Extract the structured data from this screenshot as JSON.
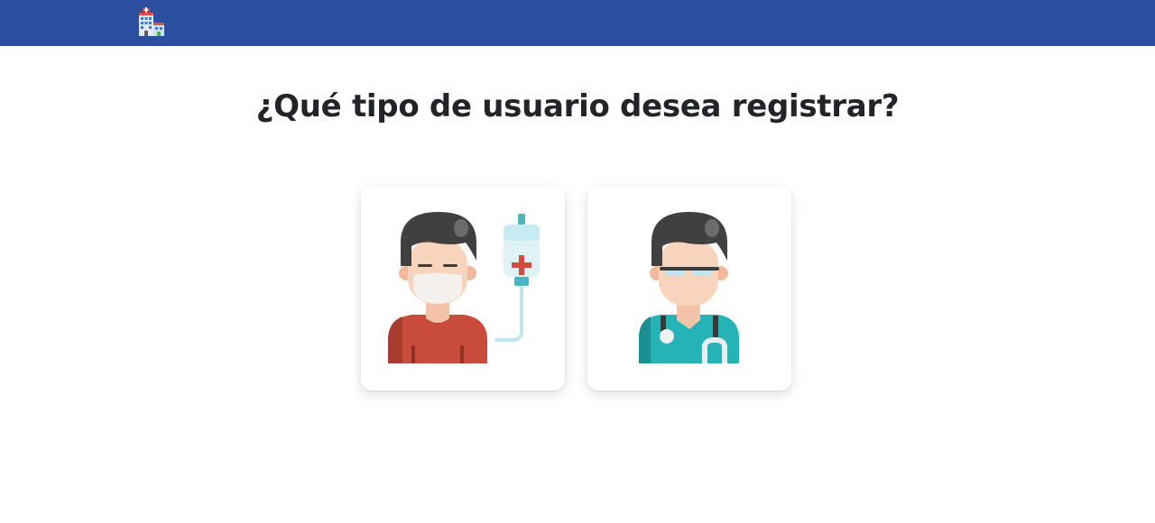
{
  "navbar": {
    "logo_icon": "hospital-building-icon",
    "background_color": "#2c4e9e"
  },
  "main": {
    "title": "¿Qué tipo de usuario desea registrar?"
  },
  "user_types": [
    {
      "id": "patient",
      "icon": "patient-with-iv-drip-icon"
    },
    {
      "id": "doctor",
      "icon": "doctor-with-stethoscope-icon"
    }
  ]
}
